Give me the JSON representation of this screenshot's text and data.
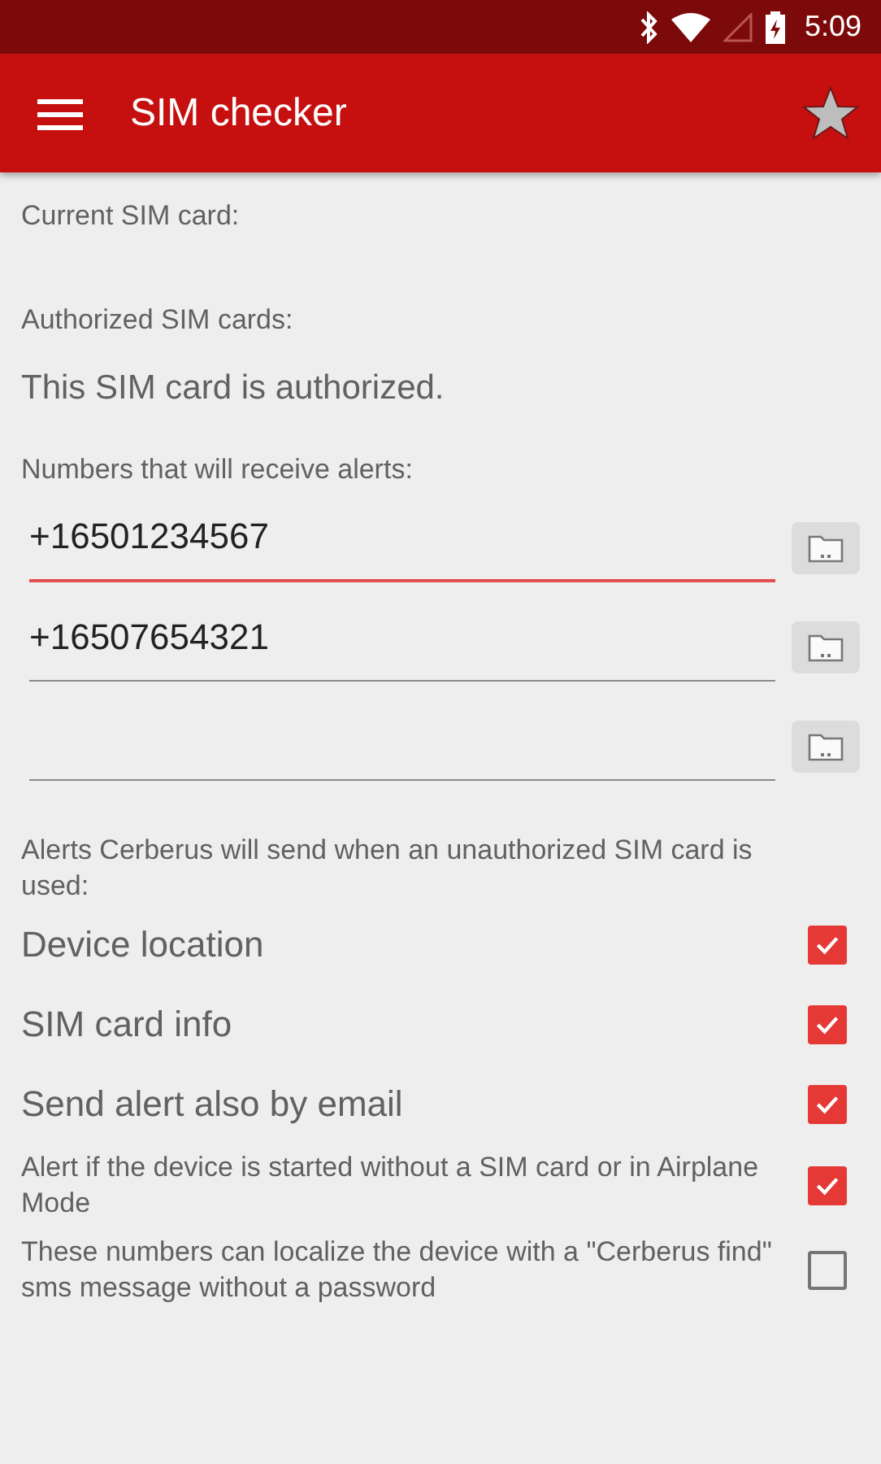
{
  "status_bar": {
    "time": "5:09"
  },
  "app_bar": {
    "title": "SIM checker"
  },
  "current_sim": {
    "label": "Current SIM card:"
  },
  "authorized": {
    "label": "Authorized SIM cards:",
    "status": "This SIM card is authorized."
  },
  "numbers": {
    "label": "Numbers that will receive alerts:",
    "fields": [
      {
        "value": "+16501234567",
        "focused": true
      },
      {
        "value": "+16507654321",
        "focused": false
      },
      {
        "focused": false
      }
    ]
  },
  "alerts": {
    "label": "Alerts Cerberus will send when an unauthorized SIM card is used:",
    "options": [
      {
        "kind": "large",
        "label": "Device location",
        "checked": true
      },
      {
        "kind": "large",
        "label": "SIM card info",
        "checked": true
      },
      {
        "kind": "large",
        "label": "Send alert also by email",
        "checked": true
      },
      {
        "kind": "small",
        "label": "Alert if the device is started without a SIM card or in Airplane Mode",
        "checked": true
      },
      {
        "kind": "small",
        "label": "These numbers can localize the device with a \"Cerberus find\" sms message without a password",
        "checked": false
      }
    ]
  }
}
